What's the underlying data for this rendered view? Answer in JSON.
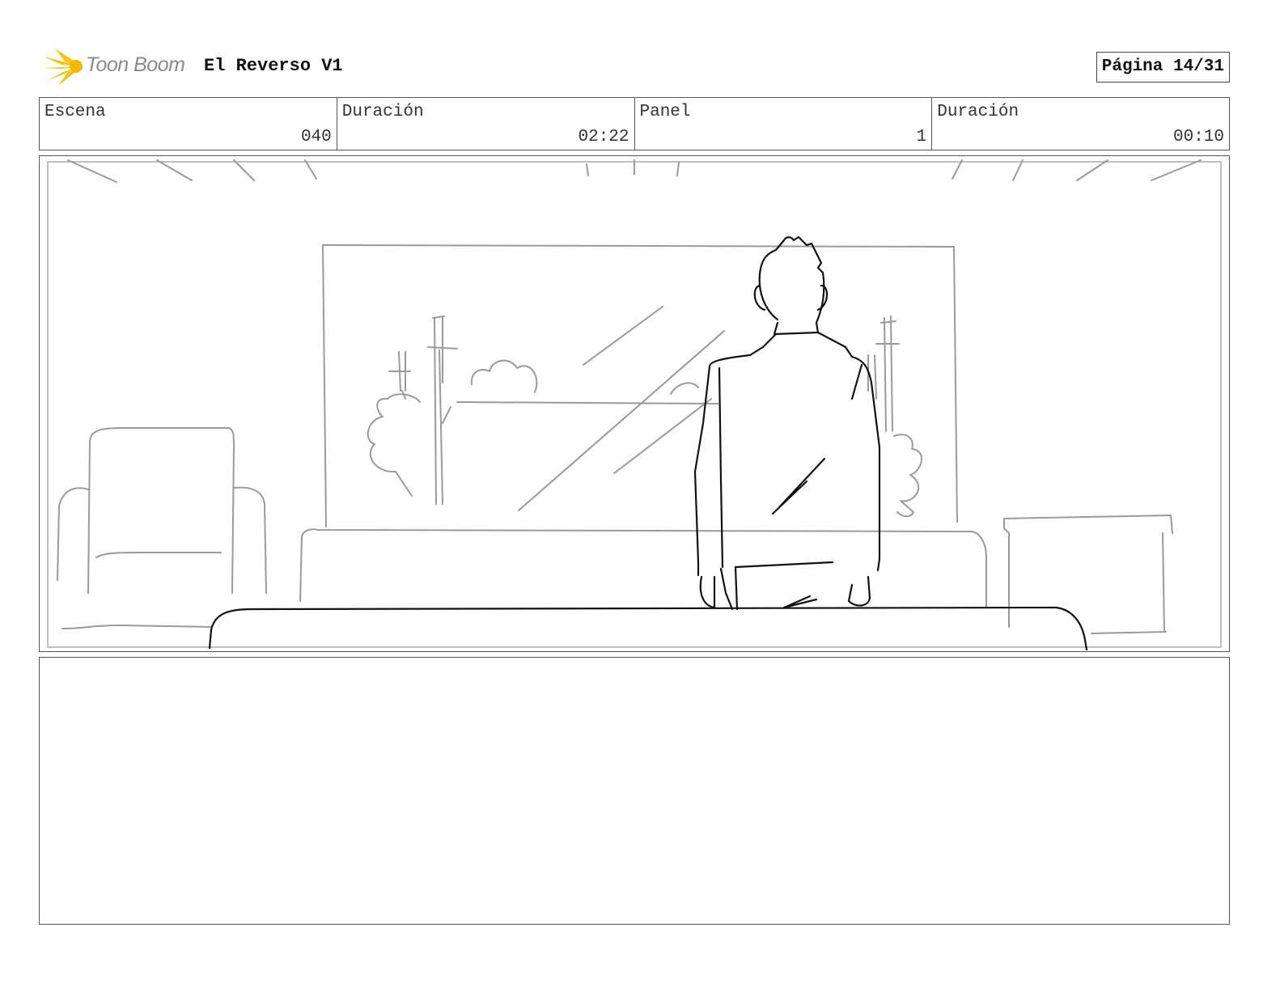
{
  "header": {
    "logo_text": "Toon Boom",
    "project_title": "El Reverso V1",
    "page_label": "Página 14/31"
  },
  "info": [
    {
      "label": "Escena",
      "value": "040"
    },
    {
      "label": "Duración",
      "value": "02:22"
    },
    {
      "label": "Panel",
      "value": "1"
    },
    {
      "label": "Duración",
      "value": "00:10"
    }
  ],
  "colors": {
    "logo_accent": "#f5c518",
    "sketch_line": "#9a9a9a",
    "ink_line": "#111111"
  }
}
